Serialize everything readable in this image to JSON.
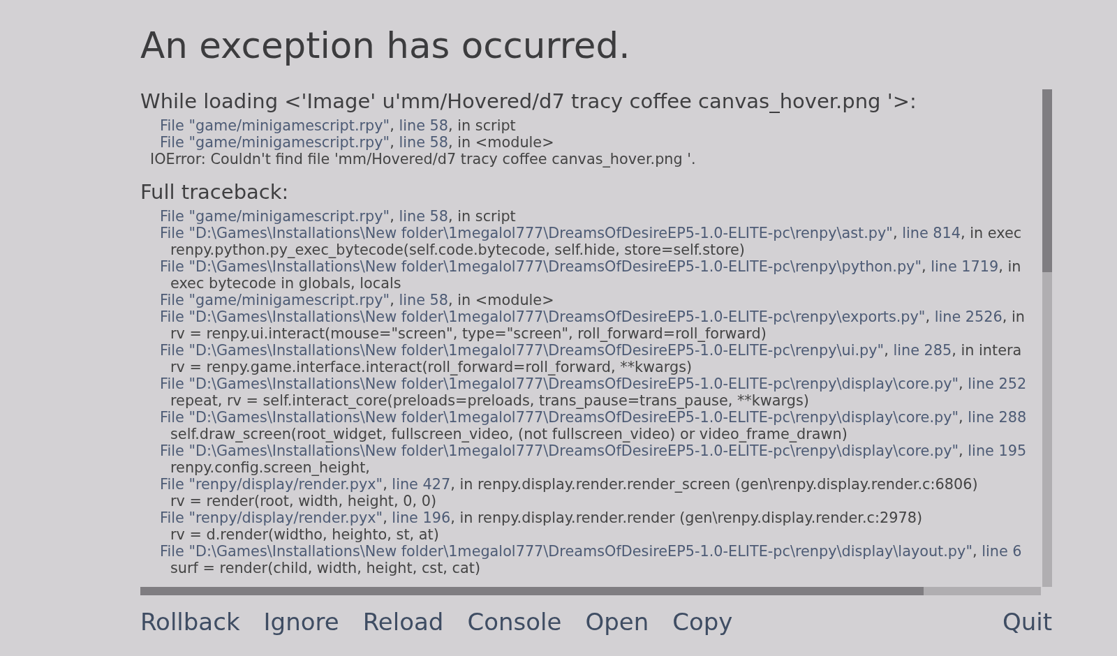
{
  "title": "An exception has occurred.",
  "error": {
    "heading": "While loading <'Image' u'mm/Hovered/d7 tracy coffee canvas_hover.png '>:",
    "lines": [
      {
        "kind": "frame",
        "parts": [
          {
            "kind": "link",
            "text": "File \"game/minigamescript.rpy\""
          },
          {
            "kind": "plain",
            "text": ", "
          },
          {
            "kind": "link",
            "text": "line 58"
          },
          {
            "kind": "plain",
            "text": ", in script"
          }
        ]
      },
      {
        "kind": "frame",
        "parts": [
          {
            "kind": "link",
            "text": "File \"game/minigamescript.rpy\""
          },
          {
            "kind": "plain",
            "text": ", "
          },
          {
            "kind": "link",
            "text": "line 58"
          },
          {
            "kind": "plain",
            "text": ", in <module>"
          }
        ]
      },
      {
        "kind": "message",
        "parts": [
          {
            "kind": "plain",
            "text": "IOError: Couldn't find file 'mm/Hovered/d7 tracy coffee canvas_hover.png '."
          }
        ]
      }
    ]
  },
  "traceback": {
    "heading": "Full traceback:",
    "lines": [
      {
        "kind": "frame",
        "parts": [
          {
            "kind": "link",
            "text": "File \"game/minigamescript.rpy\""
          },
          {
            "kind": "plain",
            "text": ", "
          },
          {
            "kind": "link",
            "text": "line 58"
          },
          {
            "kind": "plain",
            "text": ", in script"
          }
        ]
      },
      {
        "kind": "frame",
        "parts": [
          {
            "kind": "link",
            "text": "File \"D:\\Games\\Installations\\New folder\\1megalol777\\DreamsOfDesireEP5-1.0-ELITE-pc\\renpy\\ast.py\""
          },
          {
            "kind": "plain",
            "text": ", "
          },
          {
            "kind": "link",
            "text": "line 814"
          },
          {
            "kind": "plain",
            "text": ", in exec"
          }
        ]
      },
      {
        "kind": "code",
        "parts": [
          {
            "kind": "plain",
            "text": "renpy.python.py_exec_bytecode(self.code.bytecode, self.hide, store=self.store)"
          }
        ]
      },
      {
        "kind": "frame",
        "parts": [
          {
            "kind": "link",
            "text": "File \"D:\\Games\\Installations\\New folder\\1megalol777\\DreamsOfDesireEP5-1.0-ELITE-pc\\renpy\\python.py\""
          },
          {
            "kind": "plain",
            "text": ", "
          },
          {
            "kind": "link",
            "text": "line 1719"
          },
          {
            "kind": "plain",
            "text": ", in"
          }
        ]
      },
      {
        "kind": "code",
        "parts": [
          {
            "kind": "plain",
            "text": "exec bytecode in globals, locals"
          }
        ]
      },
      {
        "kind": "frame",
        "parts": [
          {
            "kind": "link",
            "text": "File \"game/minigamescript.rpy\""
          },
          {
            "kind": "plain",
            "text": ", "
          },
          {
            "kind": "link",
            "text": "line 58"
          },
          {
            "kind": "plain",
            "text": ", in <module>"
          }
        ]
      },
      {
        "kind": "frame",
        "parts": [
          {
            "kind": "link",
            "text": "File \"D:\\Games\\Installations\\New folder\\1megalol777\\DreamsOfDesireEP5-1.0-ELITE-pc\\renpy\\exports.py\""
          },
          {
            "kind": "plain",
            "text": ", "
          },
          {
            "kind": "link",
            "text": "line 2526"
          },
          {
            "kind": "plain",
            "text": ", in"
          }
        ]
      },
      {
        "kind": "code",
        "parts": [
          {
            "kind": "plain",
            "text": "rv = renpy.ui.interact(mouse=\"screen\", type=\"screen\", roll_forward=roll_forward)"
          }
        ]
      },
      {
        "kind": "frame",
        "parts": [
          {
            "kind": "link",
            "text": "File \"D:\\Games\\Installations\\New folder\\1megalol777\\DreamsOfDesireEP5-1.0-ELITE-pc\\renpy\\ui.py\""
          },
          {
            "kind": "plain",
            "text": ", "
          },
          {
            "kind": "link",
            "text": "line 285"
          },
          {
            "kind": "plain",
            "text": ", in intera"
          }
        ]
      },
      {
        "kind": "code",
        "parts": [
          {
            "kind": "plain",
            "text": "rv = renpy.game.interface.interact(roll_forward=roll_forward, **kwargs)"
          }
        ]
      },
      {
        "kind": "frame",
        "parts": [
          {
            "kind": "link",
            "text": "File \"D:\\Games\\Installations\\New folder\\1megalol777\\DreamsOfDesireEP5-1.0-ELITE-pc\\renpy\\display\\core.py\""
          },
          {
            "kind": "plain",
            "text": ", "
          },
          {
            "kind": "link",
            "text": "line 252"
          }
        ]
      },
      {
        "kind": "code",
        "parts": [
          {
            "kind": "plain",
            "text": "repeat, rv = self.interact_core(preloads=preloads, trans_pause=trans_pause, **kwargs)"
          }
        ]
      },
      {
        "kind": "frame",
        "parts": [
          {
            "kind": "link",
            "text": "File \"D:\\Games\\Installations\\New folder\\1megalol777\\DreamsOfDesireEP5-1.0-ELITE-pc\\renpy\\display\\core.py\""
          },
          {
            "kind": "plain",
            "text": ", "
          },
          {
            "kind": "link",
            "text": "line 288"
          }
        ]
      },
      {
        "kind": "code",
        "parts": [
          {
            "kind": "plain",
            "text": "self.draw_screen(root_widget, fullscreen_video, (not fullscreen_video) or video_frame_drawn)"
          }
        ]
      },
      {
        "kind": "frame",
        "parts": [
          {
            "kind": "link",
            "text": "File \"D:\\Games\\Installations\\New folder\\1megalol777\\DreamsOfDesireEP5-1.0-ELITE-pc\\renpy\\display\\core.py\""
          },
          {
            "kind": "plain",
            "text": ", "
          },
          {
            "kind": "link",
            "text": "line 195"
          }
        ]
      },
      {
        "kind": "code",
        "parts": [
          {
            "kind": "plain",
            "text": "renpy.config.screen_height,"
          }
        ]
      },
      {
        "kind": "frame",
        "parts": [
          {
            "kind": "link",
            "text": "File \"renpy/display/render.pyx\""
          },
          {
            "kind": "plain",
            "text": ", "
          },
          {
            "kind": "link",
            "text": "line 427"
          },
          {
            "kind": "plain",
            "text": ", in renpy.display.render.render_screen (gen\\renpy.display.render.c:6806)"
          }
        ]
      },
      {
        "kind": "code",
        "parts": [
          {
            "kind": "plain",
            "text": "rv = render(root, width, height, 0, 0)"
          }
        ]
      },
      {
        "kind": "frame",
        "parts": [
          {
            "kind": "link",
            "text": "File \"renpy/display/render.pyx\""
          },
          {
            "kind": "plain",
            "text": ", "
          },
          {
            "kind": "link",
            "text": "line 196"
          },
          {
            "kind": "plain",
            "text": ", in renpy.display.render.render (gen\\renpy.display.render.c:2978)"
          }
        ]
      },
      {
        "kind": "code",
        "parts": [
          {
            "kind": "plain",
            "text": "rv = d.render(widtho, heighto, st, at)"
          }
        ]
      },
      {
        "kind": "frame",
        "parts": [
          {
            "kind": "link",
            "text": "File \"D:\\Games\\Installations\\New folder\\1megalol777\\DreamsOfDesireEP5-1.0-ELITE-pc\\renpy\\display\\layout.py\""
          },
          {
            "kind": "plain",
            "text": ", "
          },
          {
            "kind": "link",
            "text": "line 6"
          }
        ]
      },
      {
        "kind": "code",
        "parts": [
          {
            "kind": "plain",
            "text": "surf = render(child, width, height, cst, cat)"
          }
        ]
      }
    ]
  },
  "actions": [
    {
      "label": "Rollback",
      "kind": "action"
    },
    {
      "label": "Ignore",
      "kind": "action"
    },
    {
      "label": "Reload",
      "kind": "action"
    },
    {
      "label": "Console",
      "kind": "action"
    },
    {
      "label": "Open",
      "kind": "action"
    },
    {
      "label": "Copy",
      "kind": "action"
    },
    {
      "label": "Quit",
      "kind": "exit"
    }
  ]
}
